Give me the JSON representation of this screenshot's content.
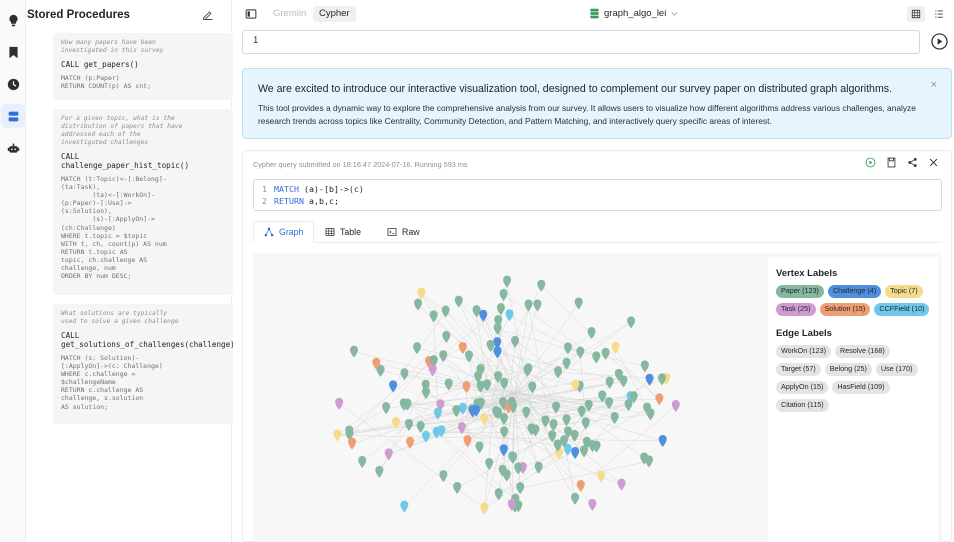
{
  "colors": {
    "paper": "#86b79f",
    "challenge": "#4f8fde",
    "topic": "#f6dc8a",
    "task": "#cf9cd1",
    "solution": "#ef9e73",
    "ccffield": "#6fcae9",
    "accent": "#2e6fd8"
  },
  "rail": {
    "icons": [
      "bulb-icon",
      "bookmark-icon",
      "clock-icon",
      "database-icon",
      "robot-icon"
    ]
  },
  "procedures": {
    "title": "Stored Procedures",
    "items": [
      {
        "comment": "How many papers have been\ninvestigated in this survey",
        "call": "CALL get_papers()",
        "query": "MATCH (p:Paper)\nRETURN COUNT(p) AS cnt;"
      },
      {
        "comment": "For a given topic, what is the\ndistribution of papers that have\naddressed each of the\ninvestigated challenges",
        "call": "CALL\nchallenge_paper_hist_topic()",
        "query": "MATCH (t:Topic)<-[:Belong]-\n(ta:Task),\n        (ta)<-[:WorkOn]-\n(p:Paper)-[:Use]->\n(s:Solution),\n        (s)-[:ApplyOn]->\n(ch:Challenge)\nWHERE t.topic = $topic\nWITH t, ch, count(p) AS num\nRETURN t.topic AS\ntopic, ch.challenge AS\nchallenge, num\nORDER BY num DESC;"
      },
      {
        "comment": "What solutions are typically\nused to solve a given challenge",
        "call": "CALL\nget_solutions_of_challenges(challenge)",
        "query": "MATCH (s: Solution)-\n[:ApplyOn]->(c: Challenge)\nWHERE c.challenge =\n$challengeName\nRETURN c.challenge AS\nchallenge, s.solution\nAS solution;"
      }
    ]
  },
  "toolbar": {
    "tab_gremlin": "Gremlin",
    "tab_cypher": "Cypher",
    "db_name": "graph_algo_lei"
  },
  "query": {
    "value": "1"
  },
  "banner": {
    "title": "We are excited to introduce our interactive visualization tool, designed to complement our survey paper on distributed graph algorithms.",
    "body": "This tool provides a dynamic way to explore the comprehensive analysis from our survey. It allows users to visualize how different algorithms address various challenges, analyze research trends across topics like Centrality, Community Detection, and Pattern Matching, and interactively query specific areas of interest.",
    "close": "×"
  },
  "result": {
    "status": "Cypher query submitted on 18:16:47 2024-07-16. Running 593 ms",
    "code_lines": [
      {
        "num": "1",
        "kw": "MATCH",
        "rest": " (a)-[b]->(c)"
      },
      {
        "num": "2",
        "kw": "RETURN",
        "rest": " a,b,c;"
      }
    ],
    "tabs": {
      "graph": "Graph",
      "table": "Table",
      "raw": "Raw"
    }
  },
  "legend": {
    "vertex_title": "Vertex Labels",
    "vertex": [
      {
        "label": "Paper (123)",
        "key": "paper"
      },
      {
        "label": "Challenge (4)",
        "key": "challenge"
      },
      {
        "label": "Topic (7)",
        "key": "topic"
      },
      {
        "label": "Task (25)",
        "key": "task"
      },
      {
        "label": "Solution (15)",
        "key": "solution"
      },
      {
        "label": "CCFField (10)",
        "key": "ccffield"
      }
    ],
    "edge_title": "Edge Labels",
    "edges": [
      "WorkOn (123)",
      "Resolve (168)",
      "Target (57)",
      "Belong (25)",
      "Use (170)",
      "ApplyOn (15)",
      "HasField (109)",
      "Citation (115)"
    ]
  }
}
